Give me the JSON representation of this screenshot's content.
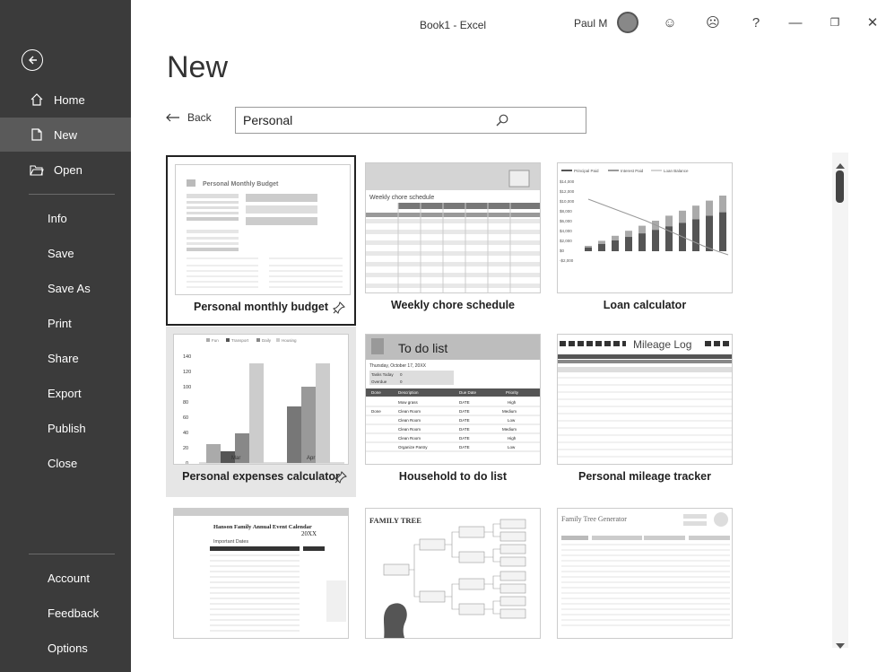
{
  "window": {
    "title": "Book1  -  Excel",
    "user": "Paul M",
    "emoji_happy": "☺",
    "emoji_sad": "☹",
    "help": "?",
    "minimize": "—",
    "restore": "❐",
    "close": "✕"
  },
  "sidebar": {
    "items": [
      {
        "label": "Home",
        "icon": "home-icon"
      },
      {
        "label": "New",
        "icon": "new-doc-icon",
        "active": true
      },
      {
        "label": "Open",
        "icon": "folder-icon"
      },
      {
        "label": "Info"
      },
      {
        "label": "Save"
      },
      {
        "label": "Save As"
      },
      {
        "label": "Print"
      },
      {
        "label": "Share"
      },
      {
        "label": "Export"
      },
      {
        "label": "Publish"
      },
      {
        "label": "Close"
      },
      {
        "label": "Account"
      },
      {
        "label": "Feedback"
      },
      {
        "label": "Options"
      }
    ]
  },
  "main": {
    "title": "New",
    "back_label": "Back",
    "search_value": "Personal"
  },
  "templates": [
    {
      "label": "Personal monthly budget",
      "thumb_title": "Personal Monthly Budget"
    },
    {
      "label": "Weekly chore schedule",
      "thumb_title": "Weekly chore schedule"
    },
    {
      "label": "Loan calculator",
      "legend": [
        "Principal Paid",
        "Interest Paid",
        "Loan Balance"
      ],
      "yticks": [
        "$14,000",
        "$12,000",
        "$10,000",
        "$8,000",
        "$6,000",
        "$4,000",
        "$2,000",
        "$0",
        "-$2,000"
      ]
    },
    {
      "label": "Personal expenses calculator",
      "legend": [
        "Fun",
        "Transport",
        "Daily",
        "Housing"
      ],
      "yticks": [
        "140",
        "120",
        "100",
        "80",
        "60",
        "40",
        "20",
        "0"
      ],
      "xticks": [
        "Mar",
        "Apr"
      ]
    },
    {
      "label": "Household to do list",
      "thumb_title": "To do list",
      "date": "Thursday, October 17, 20XX",
      "tasks_today": "Tasks Today",
      "overdue": "Overdue",
      "zero": "0",
      "cols": [
        "Done",
        "Description",
        "Due Date",
        "Priority"
      ],
      "rows": [
        [
          "",
          "Mow grass",
          "DATE",
          "High"
        ],
        [
          "Done",
          "Clean Room",
          "DATE",
          "Medium"
        ],
        [
          "",
          "Clean Room",
          "DATE",
          "Low"
        ],
        [
          "",
          "Clean Room",
          "DATE",
          "Medium"
        ],
        [
          "",
          "Clean Room",
          "DATE",
          "High"
        ],
        [
          "",
          "Organize Pantry",
          "DATE",
          "Low"
        ]
      ]
    },
    {
      "label": "Personal mileage tracker",
      "thumb_title": "Mileage Log"
    },
    {
      "label": "",
      "thumb_title": "Hanson Family Annual Event Calendar",
      "year": "20XX",
      "sub": "Important Dates"
    },
    {
      "label": "",
      "thumb_title": "FAMILY TREE"
    },
    {
      "label": "",
      "thumb_title": "Family Tree Generator"
    }
  ]
}
